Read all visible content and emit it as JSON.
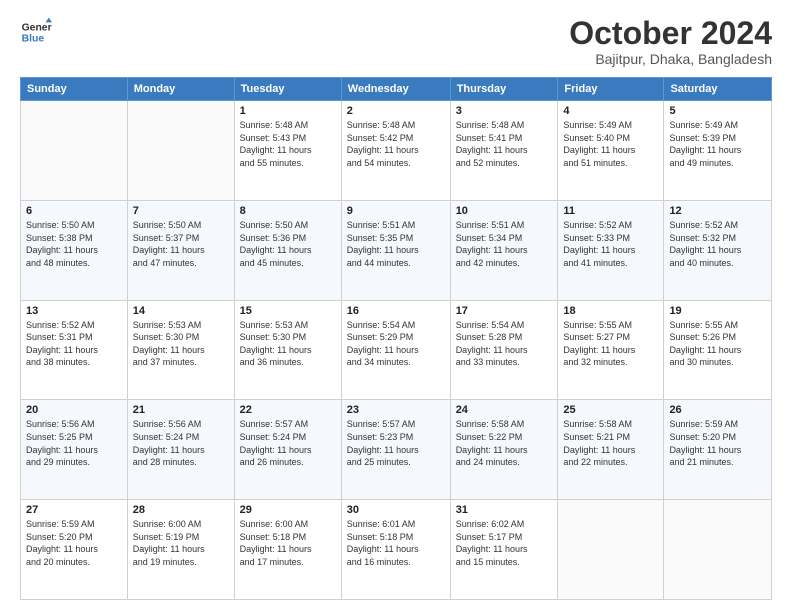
{
  "logo": {
    "line1": "General",
    "line2": "Blue"
  },
  "title": "October 2024",
  "location": "Bajitpur, Dhaka, Bangladesh",
  "weekdays": [
    "Sunday",
    "Monday",
    "Tuesday",
    "Wednesday",
    "Thursday",
    "Friday",
    "Saturday"
  ],
  "weeks": [
    [
      {
        "day": "",
        "info": ""
      },
      {
        "day": "",
        "info": ""
      },
      {
        "day": "1",
        "info": "Sunrise: 5:48 AM\nSunset: 5:43 PM\nDaylight: 11 hours\nand 55 minutes."
      },
      {
        "day": "2",
        "info": "Sunrise: 5:48 AM\nSunset: 5:42 PM\nDaylight: 11 hours\nand 54 minutes."
      },
      {
        "day": "3",
        "info": "Sunrise: 5:48 AM\nSunset: 5:41 PM\nDaylight: 11 hours\nand 52 minutes."
      },
      {
        "day": "4",
        "info": "Sunrise: 5:49 AM\nSunset: 5:40 PM\nDaylight: 11 hours\nand 51 minutes."
      },
      {
        "day": "5",
        "info": "Sunrise: 5:49 AM\nSunset: 5:39 PM\nDaylight: 11 hours\nand 49 minutes."
      }
    ],
    [
      {
        "day": "6",
        "info": "Sunrise: 5:50 AM\nSunset: 5:38 PM\nDaylight: 11 hours\nand 48 minutes."
      },
      {
        "day": "7",
        "info": "Sunrise: 5:50 AM\nSunset: 5:37 PM\nDaylight: 11 hours\nand 47 minutes."
      },
      {
        "day": "8",
        "info": "Sunrise: 5:50 AM\nSunset: 5:36 PM\nDaylight: 11 hours\nand 45 minutes."
      },
      {
        "day": "9",
        "info": "Sunrise: 5:51 AM\nSunset: 5:35 PM\nDaylight: 11 hours\nand 44 minutes."
      },
      {
        "day": "10",
        "info": "Sunrise: 5:51 AM\nSunset: 5:34 PM\nDaylight: 11 hours\nand 42 minutes."
      },
      {
        "day": "11",
        "info": "Sunrise: 5:52 AM\nSunset: 5:33 PM\nDaylight: 11 hours\nand 41 minutes."
      },
      {
        "day": "12",
        "info": "Sunrise: 5:52 AM\nSunset: 5:32 PM\nDaylight: 11 hours\nand 40 minutes."
      }
    ],
    [
      {
        "day": "13",
        "info": "Sunrise: 5:52 AM\nSunset: 5:31 PM\nDaylight: 11 hours\nand 38 minutes."
      },
      {
        "day": "14",
        "info": "Sunrise: 5:53 AM\nSunset: 5:30 PM\nDaylight: 11 hours\nand 37 minutes."
      },
      {
        "day": "15",
        "info": "Sunrise: 5:53 AM\nSunset: 5:30 PM\nDaylight: 11 hours\nand 36 minutes."
      },
      {
        "day": "16",
        "info": "Sunrise: 5:54 AM\nSunset: 5:29 PM\nDaylight: 11 hours\nand 34 minutes."
      },
      {
        "day": "17",
        "info": "Sunrise: 5:54 AM\nSunset: 5:28 PM\nDaylight: 11 hours\nand 33 minutes."
      },
      {
        "day": "18",
        "info": "Sunrise: 5:55 AM\nSunset: 5:27 PM\nDaylight: 11 hours\nand 32 minutes."
      },
      {
        "day": "19",
        "info": "Sunrise: 5:55 AM\nSunset: 5:26 PM\nDaylight: 11 hours\nand 30 minutes."
      }
    ],
    [
      {
        "day": "20",
        "info": "Sunrise: 5:56 AM\nSunset: 5:25 PM\nDaylight: 11 hours\nand 29 minutes."
      },
      {
        "day": "21",
        "info": "Sunrise: 5:56 AM\nSunset: 5:24 PM\nDaylight: 11 hours\nand 28 minutes."
      },
      {
        "day": "22",
        "info": "Sunrise: 5:57 AM\nSunset: 5:24 PM\nDaylight: 11 hours\nand 26 minutes."
      },
      {
        "day": "23",
        "info": "Sunrise: 5:57 AM\nSunset: 5:23 PM\nDaylight: 11 hours\nand 25 minutes."
      },
      {
        "day": "24",
        "info": "Sunrise: 5:58 AM\nSunset: 5:22 PM\nDaylight: 11 hours\nand 24 minutes."
      },
      {
        "day": "25",
        "info": "Sunrise: 5:58 AM\nSunset: 5:21 PM\nDaylight: 11 hours\nand 22 minutes."
      },
      {
        "day": "26",
        "info": "Sunrise: 5:59 AM\nSunset: 5:20 PM\nDaylight: 11 hours\nand 21 minutes."
      }
    ],
    [
      {
        "day": "27",
        "info": "Sunrise: 5:59 AM\nSunset: 5:20 PM\nDaylight: 11 hours\nand 20 minutes."
      },
      {
        "day": "28",
        "info": "Sunrise: 6:00 AM\nSunset: 5:19 PM\nDaylight: 11 hours\nand 19 minutes."
      },
      {
        "day": "29",
        "info": "Sunrise: 6:00 AM\nSunset: 5:18 PM\nDaylight: 11 hours\nand 17 minutes."
      },
      {
        "day": "30",
        "info": "Sunrise: 6:01 AM\nSunset: 5:18 PM\nDaylight: 11 hours\nand 16 minutes."
      },
      {
        "day": "31",
        "info": "Sunrise: 6:02 AM\nSunset: 5:17 PM\nDaylight: 11 hours\nand 15 minutes."
      },
      {
        "day": "",
        "info": ""
      },
      {
        "day": "",
        "info": ""
      }
    ]
  ]
}
